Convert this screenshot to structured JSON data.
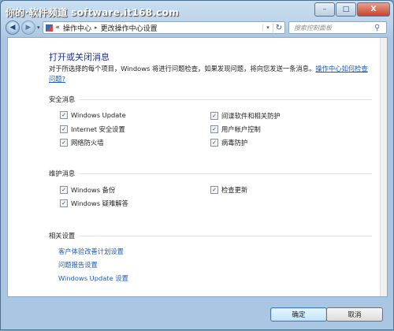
{
  "watermark": "你的·软件频道 software.it168.com",
  "window_controls": {
    "minimize": "–",
    "maximize": "□",
    "close": "X"
  },
  "nav": {
    "back": "◀",
    "forward": "▶",
    "history": "▾"
  },
  "address": {
    "overflow": "«",
    "crumbs": [
      "操作中心",
      "更改操作中心设置"
    ],
    "separator": "▸",
    "dropdown": "▾",
    "refresh": "↻"
  },
  "search": {
    "placeholder": "搜索控制面板",
    "icon": "search-icon",
    "glyph": "⚲"
  },
  "page": {
    "title": "打开或关闭消息",
    "description": "对于所选择的每个项目，Windows 将进行问题检查，如果发现问题，将向您发送一条消息。",
    "description_link": "操作中心如何检查问题?"
  },
  "security": {
    "heading": "安全消息",
    "items": [
      {
        "label": "Windows Update",
        "checked": true
      },
      {
        "label": "间谍软件和相关防护",
        "checked": true
      },
      {
        "label": "Internet 安全设置",
        "checked": true
      },
      {
        "label": "用户帐户控制",
        "checked": true
      },
      {
        "label": "网络防火墙",
        "checked": true
      },
      {
        "label": "病毒防护",
        "checked": true
      }
    ]
  },
  "maintenance": {
    "heading": "维护消息",
    "items": [
      {
        "label": "Windows 备份",
        "checked": true
      },
      {
        "label": "检查更新",
        "checked": true
      },
      {
        "label": "Windows 疑难解答",
        "checked": true
      }
    ]
  },
  "related": {
    "heading": "相关设置",
    "links": [
      "客户体验改善计划设置",
      "问题报告设置",
      "Windows Update 设置"
    ]
  },
  "buttons": {
    "ok": "确定",
    "cancel": "取消"
  },
  "check_glyph": "✓"
}
